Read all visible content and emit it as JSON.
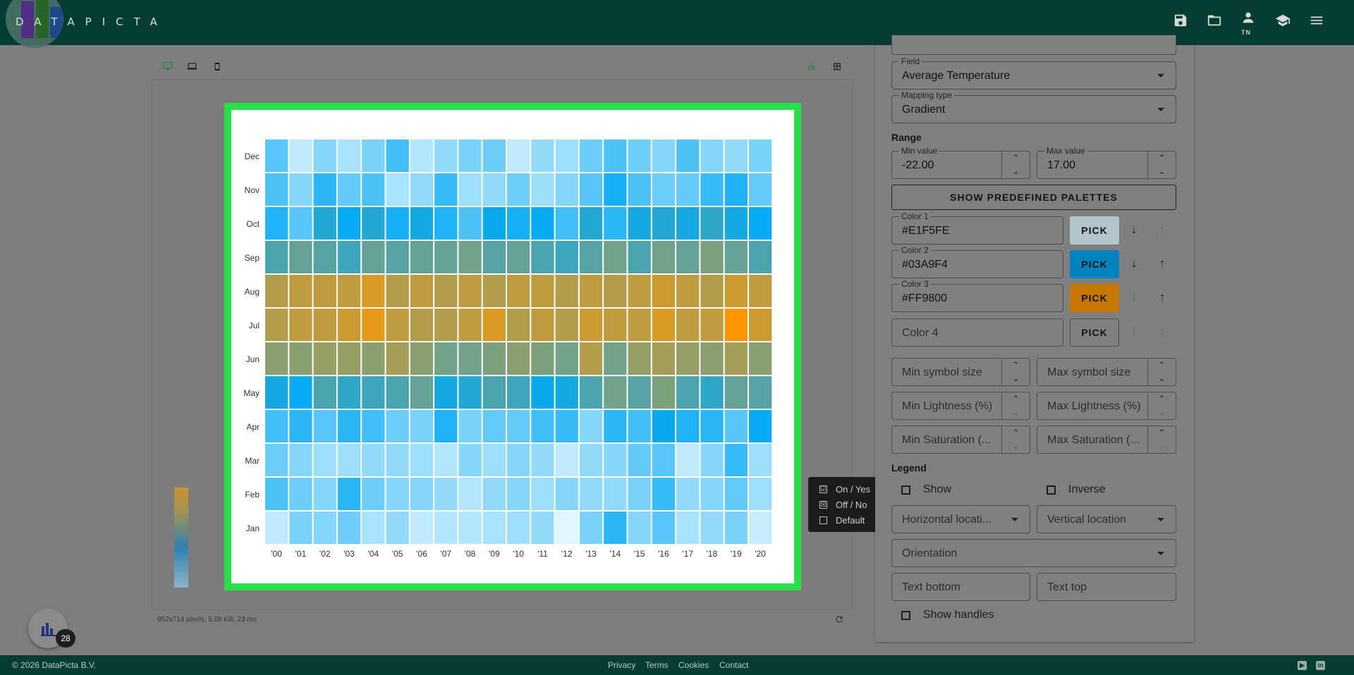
{
  "app": {
    "logo_text": "DATAPICTA",
    "user_initials": "TN",
    "icons": [
      "save-icon",
      "folder-open-icon",
      "user-icon",
      "graduation-cap-icon",
      "menu-icon"
    ]
  },
  "toolbar": {
    "device_icons": [
      "desktop-icon",
      "laptop-icon",
      "phone-icon"
    ],
    "view_icons": [
      "chart-view-icon",
      "table-view-icon"
    ]
  },
  "chart_data": {
    "type": "heatmap",
    "x": [
      "'00",
      "'01",
      "'02",
      "'03",
      "'04",
      "'05",
      "'06",
      "'07",
      "'08",
      "'09",
      "'10",
      "'11",
      "'12",
      "'13",
      "'14",
      "'15",
      "'16",
      "'17",
      "'18",
      "'19",
      "'20"
    ],
    "y": [
      "Dec",
      "Nov",
      "Oct",
      "Sep",
      "Aug",
      "Jul",
      "Jun",
      "May",
      "Apr",
      "Mar",
      "Feb",
      "Jan"
    ],
    "value_field": "Average Temperature",
    "value_range": [
      -22.0,
      17.0
    ],
    "gradient_colors": [
      "#E1F5FE",
      "#03A9F4",
      "#FF9800"
    ],
    "values": [
      [
        -10,
        -19,
        -14,
        -17,
        -13,
        -8,
        -18,
        -15,
        -13,
        -12,
        -19,
        -15,
        -16,
        -12,
        -9,
        -12,
        -14,
        -9,
        -14,
        -15,
        -13
      ],
      [
        -9,
        -14,
        -6,
        -11,
        -9,
        -17,
        -15,
        -7,
        -16,
        -15,
        -12,
        -16,
        -14,
        -10,
        -4,
        -9,
        -12,
        -11,
        -7,
        -5,
        -11
      ],
      [
        -5,
        -10,
        0,
        -3,
        0,
        -4,
        -1,
        -5,
        -9,
        -2,
        -4,
        -3,
        -8,
        0,
        -6,
        -1,
        0,
        -1,
        1,
        -1,
        -3
      ],
      [
        3,
        5,
        4,
        2,
        5,
        4,
        5,
        5,
        6,
        4,
        5,
        3,
        2,
        4,
        6,
        3,
        6,
        5,
        7,
        5,
        3
      ],
      [
        11,
        12,
        12,
        12,
        14,
        11,
        12,
        11,
        12,
        11,
        12,
        12,
        11,
        12,
        11,
        12,
        13,
        12,
        11,
        13,
        12
      ],
      [
        11,
        12,
        12,
        13,
        15,
        12,
        11,
        11,
        12,
        14,
        11,
        12,
        11,
        13,
        12,
        12,
        14,
        12,
        12,
        17,
        13
      ],
      [
        8,
        8,
        9,
        9,
        8,
        10,
        8,
        6,
        6,
        7,
        8,
        7,
        6,
        11,
        6,
        9,
        10,
        9,
        8,
        10,
        8
      ],
      [
        -1,
        -3,
        3,
        1,
        2,
        3,
        5,
        -1,
        0,
        3,
        2,
        -2,
        -1,
        3,
        6,
        4,
        7,
        3,
        1,
        5,
        4
      ],
      [
        -8,
        -6,
        -10,
        -6,
        -8,
        -12,
        -13,
        -5,
        -13,
        -11,
        -11,
        -8,
        -7,
        -14,
        -6,
        -8,
        -2,
        -5,
        -6,
        -10,
        -3
      ],
      [
        -12,
        -14,
        -16,
        -16,
        -15,
        -15,
        -16,
        -18,
        -14,
        -16,
        -14,
        -15,
        -19,
        -15,
        -14,
        -11,
        -10,
        -19,
        -14,
        -7,
        -16
      ],
      [
        -9,
        -12,
        -14,
        -6,
        -12,
        -14,
        -14,
        -15,
        -18,
        -15,
        -14,
        -16,
        -14,
        -15,
        -15,
        -13,
        -7,
        -15,
        -14,
        -11,
        -16
      ],
      [
        -19,
        -13,
        -14,
        -12,
        -17,
        -15,
        -19,
        -18,
        -18,
        -17,
        -16,
        -15,
        -22,
        -13,
        -6,
        -14,
        -10,
        -17,
        -15,
        -13,
        -20
      ]
    ]
  },
  "legend_tooltip": {
    "items": [
      {
        "label": "On / Yes",
        "mark": "☑"
      },
      {
        "label": "Off / No",
        "mark": "☒"
      },
      {
        "label": "Default",
        "mark": ""
      }
    ]
  },
  "status": {
    "info": "952x714 pixels, 5.08 KB, 23 ms",
    "badge_count": "28"
  },
  "panel": {
    "field": {
      "label": "Field",
      "value": "Average Temperature"
    },
    "mapping_type": {
      "label": "Mapping type",
      "value": "Gradient"
    },
    "range_label": "Range",
    "min_value": {
      "label": "Min value",
      "value": "-22.00"
    },
    "max_value": {
      "label": "Max value",
      "value": "17.00"
    },
    "predefined_button": "SHOW PREDEFINED PALETTES",
    "colors": [
      {
        "label": "Color 1",
        "value": "#E1F5FE",
        "swatch": "#b1c3cb"
      },
      {
        "label": "Color 2",
        "value": "#03A9F4",
        "swatch": "#0383bd"
      },
      {
        "label": "Color 3",
        "value": "#FF9800",
        "swatch": "#c67704"
      },
      {
        "label": "",
        "placeholder": "Color 4",
        "value": "",
        "swatch": "#808080"
      }
    ],
    "pick_label": "PICK",
    "min_symbol_size": "Min symbol size",
    "max_symbol_size": "Max symbol size",
    "min_lightness": "Min Lightness (%)",
    "max_lightness": "Max Lightness (%)",
    "min_saturation": "Min Saturation (...",
    "max_saturation": "Max Saturation (...",
    "legend_label": "Legend",
    "show_label": "Show",
    "inverse_label": "Inverse",
    "horizontal_location": "Horizontal locati...",
    "vertical_location": "Vertical location",
    "orientation": "Orientation",
    "text_bottom": "Text bottom",
    "text_top": "Text top",
    "show_handles": "Show handles"
  },
  "footer": {
    "copyright": "© 2026 DataPicta B.V.",
    "links": [
      "Privacy",
      "Terms",
      "Cookies",
      "Contact"
    ]
  }
}
